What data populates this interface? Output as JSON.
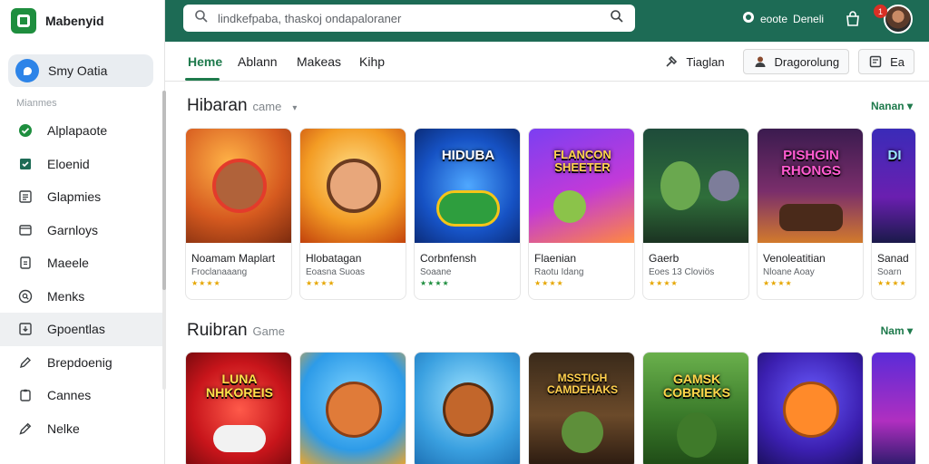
{
  "brand": {
    "name": "Mabenyid"
  },
  "search": {
    "placeholder": "lindkefpaba, thaskoj ondapaloraner"
  },
  "topbar": {
    "user_label": "Deneli",
    "badge": "1",
    "user_prefix": "eoote"
  },
  "sidebar": {
    "primary": "Smy Oatia",
    "section": "Mianmes",
    "items": [
      {
        "label": "Alplapaote",
        "icon": "check-circle-icon"
      },
      {
        "label": "Eloenid",
        "icon": "bookmark-check-icon"
      },
      {
        "label": "Glapmies",
        "icon": "list-icon"
      },
      {
        "label": "Garnloys",
        "icon": "window-icon"
      },
      {
        "label": "Maeele",
        "icon": "tablet-icon"
      },
      {
        "label": "Menks",
        "icon": "search-circle-icon"
      },
      {
        "label": "Gpoentlas",
        "icon": "download-box-icon"
      },
      {
        "label": "Brepdoenig",
        "icon": "pen-icon"
      },
      {
        "label": "Cannes",
        "icon": "clipboard-icon"
      },
      {
        "label": "Nelke",
        "icon": "pencil-icon"
      }
    ]
  },
  "tabs": [
    {
      "label": "Heme"
    },
    {
      "label": "Ablann"
    },
    {
      "label": "Makeas"
    },
    {
      "label": "Kihp"
    }
  ],
  "tools": {
    "edit_label": "Tiaglan",
    "account_label": "Dragorolung",
    "more_label": "Ea"
  },
  "sections": [
    {
      "title": "Hibaran",
      "subtitle": "came",
      "more": "Nanan",
      "cards": [
        {
          "title": "Noamam Maplart",
          "sub": "Froclanaaang",
          "stars": "★★★★",
          "thumb_label": ""
        },
        {
          "title": "Hlobatagan",
          "sub": "Eoasna Suoas",
          "stars": "★★★★",
          "thumb_label": ""
        },
        {
          "title": "Corbnfensh",
          "sub": "Soaane",
          "stars": "★★★★",
          "thumb_label": "HIDUBA"
        },
        {
          "title": "Flaenian",
          "sub": "Raotu Idang",
          "stars": "★★★★",
          "thumb_label": "FLANCON SHEETER"
        },
        {
          "title": "Gaerb",
          "sub": "Eoes 13 Cloviös",
          "stars": "★★★★",
          "thumb_label": ""
        },
        {
          "title": "Venoleatitian",
          "sub": "Nloane Aoay",
          "stars": "★★★★",
          "thumb_label": "PISHGIN RHONGS"
        },
        {
          "title": "Sanad",
          "sub": "Soarn",
          "stars": "★★★★",
          "thumb_label": "DI"
        }
      ]
    },
    {
      "title": "Ruibran",
      "subtitle": "Game",
      "more": "Nam",
      "cards": [
        {
          "title": "",
          "sub": "",
          "stars": "",
          "thumb_label": "LUNA NHKOREIS"
        },
        {
          "title": "",
          "sub": "",
          "stars": "",
          "thumb_label": ""
        },
        {
          "title": "",
          "sub": "",
          "stars": "",
          "thumb_label": ""
        },
        {
          "title": "",
          "sub": "",
          "stars": "",
          "thumb_label": "MSSTIGH CAMDEHAKS"
        },
        {
          "title": "",
          "sub": "",
          "stars": "",
          "thumb_label": "GAMSK COBRIEKS"
        },
        {
          "title": "",
          "sub": "",
          "stars": "",
          "thumb_label": ""
        },
        {
          "title": "",
          "sub": "",
          "stars": "",
          "thumb_label": ""
        }
      ]
    }
  ],
  "colors": {
    "topbar": "#1d6b55",
    "accent": "#1e7a4c",
    "brand": "#1e8e3e",
    "star": "#e6a600"
  }
}
